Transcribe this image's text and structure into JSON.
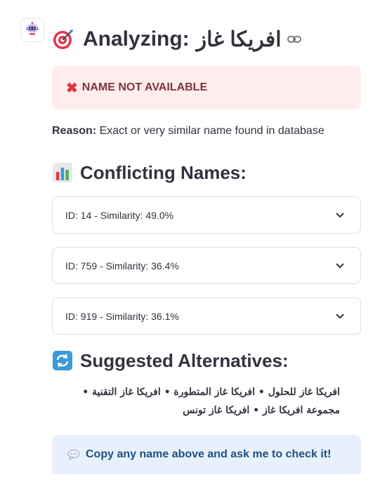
{
  "header": {
    "title_prefix": "Analyzing:",
    "title_name": "افريكا غاز"
  },
  "status": {
    "error_text": "NAME NOT AVAILABLE",
    "reason_label": "Reason:",
    "reason_text": " Exact or very similar name found in database"
  },
  "conflicts": {
    "heading": "Conflicting Names:",
    "items": [
      {
        "label": "ID: 14 - Similarity: 49.0%"
      },
      {
        "label": "ID: 759 - Similarity: 36.4%"
      },
      {
        "label": "ID: 919 - Similarity: 36.1%"
      }
    ]
  },
  "alternatives": {
    "heading": "Suggested Alternatives:",
    "text": "افريكا غاز للحلول • افريكا غاز المتطورة • افريكا غاز التقنية • مجموعة افريكا غاز • افريكا غاز تونس"
  },
  "info": {
    "text": "Copy any name above and ask me to check it!"
  },
  "icons": {
    "avatar": "robot-icon",
    "title": "target-icon",
    "link": "link-icon",
    "error": "cross-mark-icon",
    "conflicts": "bar-chart-icon",
    "alternatives": "refresh-icon",
    "info": "speech-bubble-icon",
    "expander": "chevron-down-icon"
  },
  "colors": {
    "error_bg": "#ffecec",
    "error_text": "#7d353b",
    "info_bg": "#e8f1fb",
    "info_text": "#1e4f84"
  }
}
